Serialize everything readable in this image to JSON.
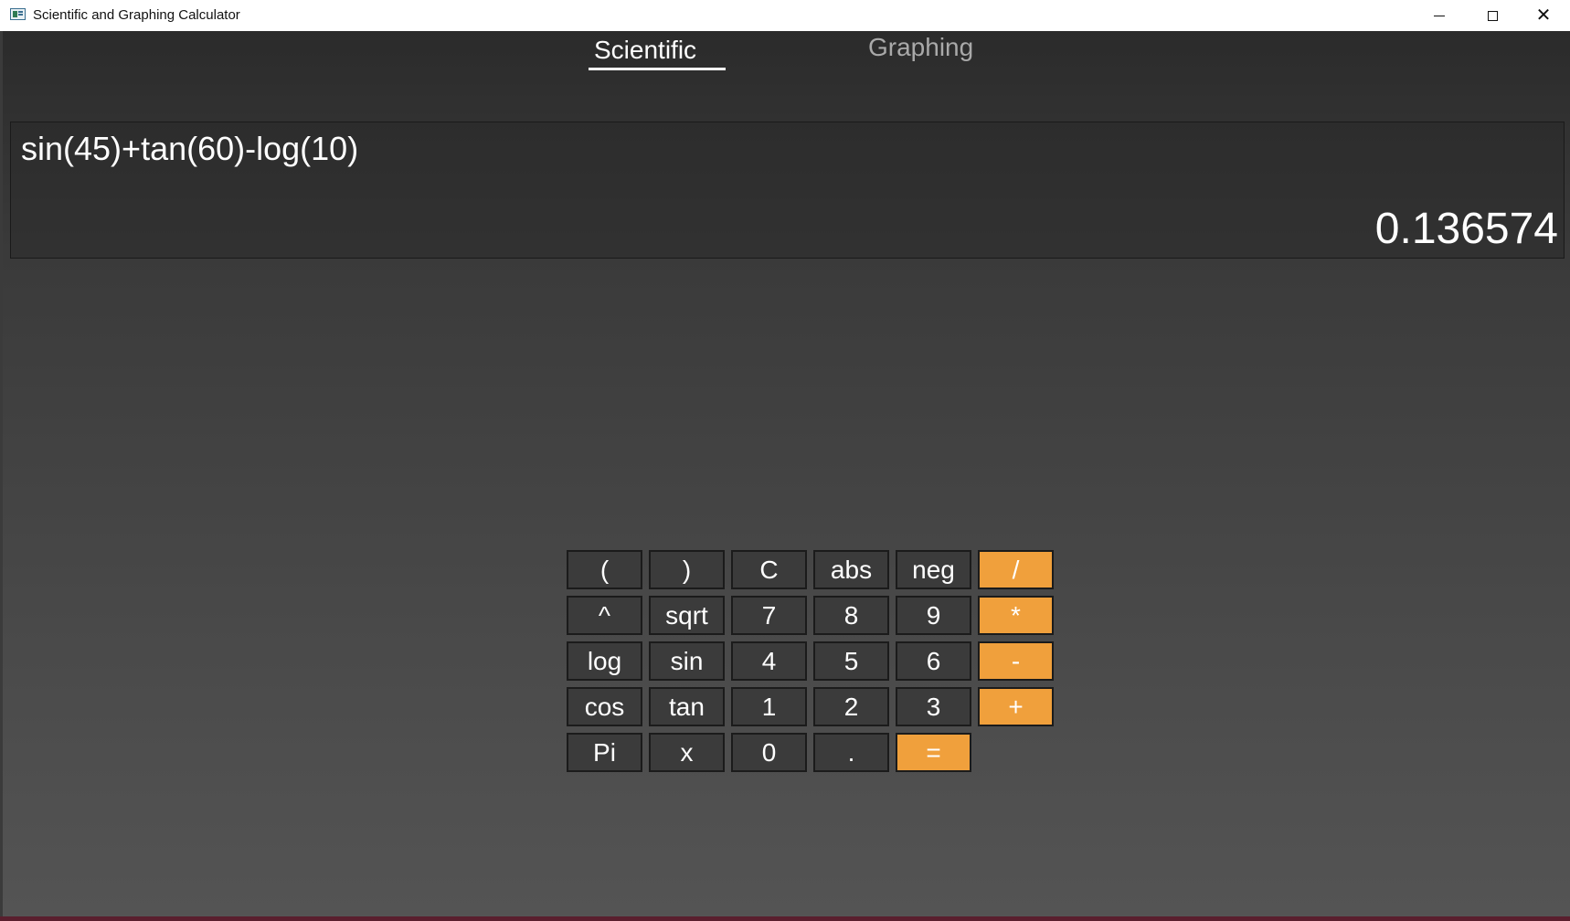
{
  "window": {
    "title": "Scientific and Graphing Calculator"
  },
  "tabs": [
    {
      "label": "Scientific",
      "active": true
    },
    {
      "label": "Graphing",
      "active": false
    }
  ],
  "display": {
    "expression": "sin(45)+tan(60)-log(10)",
    "result": "0.136574"
  },
  "keypad": {
    "rows": [
      [
        "(",
        ")",
        "C",
        "abs",
        "neg",
        "/"
      ],
      [
        "^",
        "sqrt",
        "7",
        "8",
        "9",
        "*"
      ],
      [
        "log",
        "sin",
        "4",
        "5",
        "6",
        "-"
      ],
      [
        "cos",
        "tan",
        "1",
        "2",
        "3",
        "+"
      ],
      [
        "Pi",
        "x",
        "0",
        ".",
        "="
      ]
    ],
    "operator_color": "#f0a03c",
    "key_color": "#3b3b3b"
  }
}
